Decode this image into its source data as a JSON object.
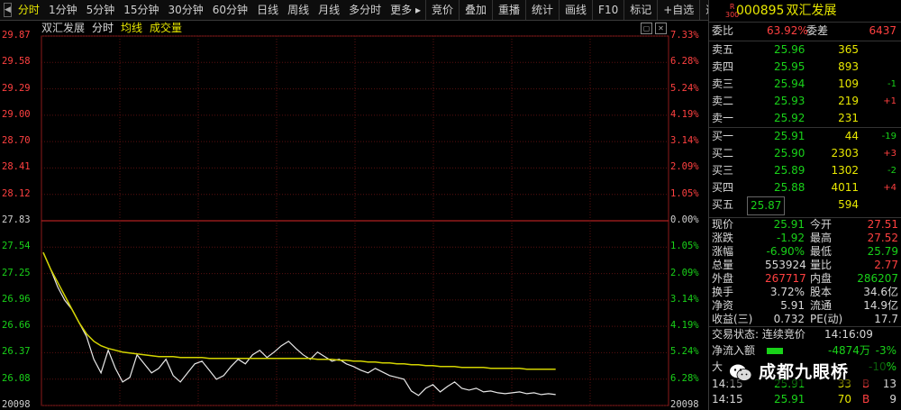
{
  "toolbar": {
    "items": [
      "分时",
      "1分钟",
      "5分钟",
      "15分钟",
      "30分钟",
      "60分钟",
      "日线",
      "周线",
      "月线",
      "多分时",
      "更多 ▸"
    ],
    "right_items": [
      "竞价",
      "叠加",
      "重播",
      "统计",
      "画线",
      "F10",
      "标记",
      "+自选",
      "返回"
    ],
    "active_index": 0
  },
  "chart_head": {
    "symbol": "双汇发展",
    "fenshi": "分时",
    "avg": "均线",
    "vol": "成交量"
  },
  "axis": {
    "left": [
      "29.87",
      "29.58",
      "29.29",
      "29.00",
      "28.70",
      "28.41",
      "28.12",
      "27.83",
      "27.54",
      "27.25",
      "26.96",
      "26.66",
      "26.37",
      "26.08",
      "20098"
    ],
    "right": [
      "7.33%",
      "6.28%",
      "5.24%",
      "4.19%",
      "3.14%",
      "2.09%",
      "1.05%",
      "0.00%",
      "1.05%",
      "2.09%",
      "3.14%",
      "4.19%",
      "5.24%",
      "6.28%",
      "20098"
    ]
  },
  "chart_data": {
    "type": "line",
    "prev_close": 27.83,
    "ylim": [
      25.79,
      29.87
    ],
    "series": [
      {
        "name": "分时",
        "values": [
          27.48,
          27.3,
          27.1,
          26.95,
          26.85,
          26.7,
          26.55,
          26.3,
          26.15,
          26.4,
          26.2,
          26.05,
          26.1,
          26.35,
          26.25,
          26.15,
          26.2,
          26.3,
          26.12,
          26.05,
          26.15,
          26.25,
          26.28,
          26.18,
          26.08,
          26.12,
          26.22,
          26.3,
          26.25,
          26.35,
          26.4,
          26.32,
          26.38,
          26.45,
          26.5,
          26.42,
          26.35,
          26.3,
          26.38,
          26.33,
          26.28,
          26.3,
          26.25,
          26.22,
          26.18,
          26.15,
          26.2,
          26.16,
          26.12,
          26.1,
          26.08,
          25.95,
          25.9,
          25.98,
          26.02,
          25.94,
          26.0,
          26.05,
          25.98,
          25.96,
          25.98,
          25.94,
          25.95,
          25.93,
          25.92,
          25.93,
          25.94,
          25.92,
          25.93,
          25.91,
          25.92,
          25.91
        ]
      },
      {
        "name": "均线",
        "values": [
          27.48,
          27.3,
          27.15,
          27.0,
          26.85,
          26.7,
          26.58,
          26.5,
          26.45,
          26.42,
          26.4,
          26.38,
          26.37,
          26.36,
          26.35,
          26.34,
          26.33,
          26.33,
          26.33,
          26.32,
          26.32,
          26.32,
          26.32,
          26.31,
          26.31,
          26.31,
          26.31,
          26.31,
          26.31,
          26.31,
          26.31,
          26.31,
          26.31,
          26.31,
          26.31,
          26.31,
          26.31,
          26.31,
          26.3,
          26.3,
          26.3,
          26.29,
          26.29,
          26.28,
          26.28,
          26.27,
          26.27,
          26.26,
          26.26,
          26.25,
          26.25,
          26.24,
          26.24,
          26.23,
          26.23,
          26.22,
          26.22,
          26.22,
          26.21,
          26.21,
          26.21,
          26.21,
          26.2,
          26.2,
          26.2,
          26.2,
          26.2,
          26.19,
          26.19,
          26.19,
          26.19,
          26.19
        ]
      }
    ]
  },
  "quote": {
    "badge_r": "R",
    "badge_num": "300",
    "code": "000895",
    "name": "双汇发展",
    "weibi_label": "委比",
    "weibi_value": "63.92%",
    "weicha_label": "委差",
    "weicha_value": "6437",
    "asks": [
      {
        "label": "卖五",
        "price": "25.96",
        "vol": "365",
        "chg": ""
      },
      {
        "label": "卖四",
        "price": "25.95",
        "vol": "893",
        "chg": ""
      },
      {
        "label": "卖三",
        "price": "25.94",
        "vol": "109",
        "chg": "-1"
      },
      {
        "label": "卖二",
        "price": "25.93",
        "vol": "219",
        "chg": "+1"
      },
      {
        "label": "卖一",
        "price": "25.92",
        "vol": "231",
        "chg": ""
      }
    ],
    "bids": [
      {
        "label": "买一",
        "price": "25.91",
        "vol": "44",
        "chg": "-19"
      },
      {
        "label": "买二",
        "price": "25.90",
        "vol": "2303",
        "chg": "+3"
      },
      {
        "label": "买三",
        "price": "25.89",
        "vol": "1302",
        "chg": "-2"
      },
      {
        "label": "买四",
        "price": "25.88",
        "vol": "4011",
        "chg": "+4"
      },
      {
        "label": "买五",
        "price": "25.87",
        "vol": "594",
        "chg": ""
      }
    ],
    "stats": [
      {
        "l1": "现价",
        "v1": "25.91",
        "l2": "今开",
        "v2": "27.51"
      },
      {
        "l1": "涨跌",
        "v1": "-1.92",
        "l2": "最高",
        "v2": "27.52"
      },
      {
        "l1": "涨幅",
        "v1": "-6.90%",
        "l2": "最低",
        "v2": "25.79"
      },
      {
        "l1": "总量",
        "v1": "553924",
        "l2": "量比",
        "v2": "2.77"
      },
      {
        "l1": "外盘",
        "v1": "267717",
        "l2": "内盘",
        "v2": "286207"
      },
      {
        "l1": "换手",
        "v1": "3.72%",
        "l2": "股本",
        "v2": "34.6亿"
      },
      {
        "l1": "净资",
        "v1": "5.91",
        "l2": "流通",
        "v2": "14.9亿"
      },
      {
        "l1": "收益(三)",
        "v1": "0.732",
        "l2": "PE(动)",
        "v2": "17.7"
      }
    ],
    "status_label": "交易状态: 连续竞价",
    "status_time": "14:16:09",
    "netflow_label": "净流入额",
    "netflow_value": "-4874万",
    "netflow_pct": "-3%",
    "big_label": "大",
    "big_pct": "-10%",
    "ticks": [
      {
        "time": "14:15",
        "price": "25.91",
        "vol": "33",
        "dir": "B",
        "n": "13"
      },
      {
        "time": "14:15",
        "price": "25.91",
        "vol": "70",
        "dir": "B",
        "n": "9"
      }
    ]
  },
  "watermark": {
    "text": "成都九眼桥",
    "icon": "wechat-icon"
  }
}
